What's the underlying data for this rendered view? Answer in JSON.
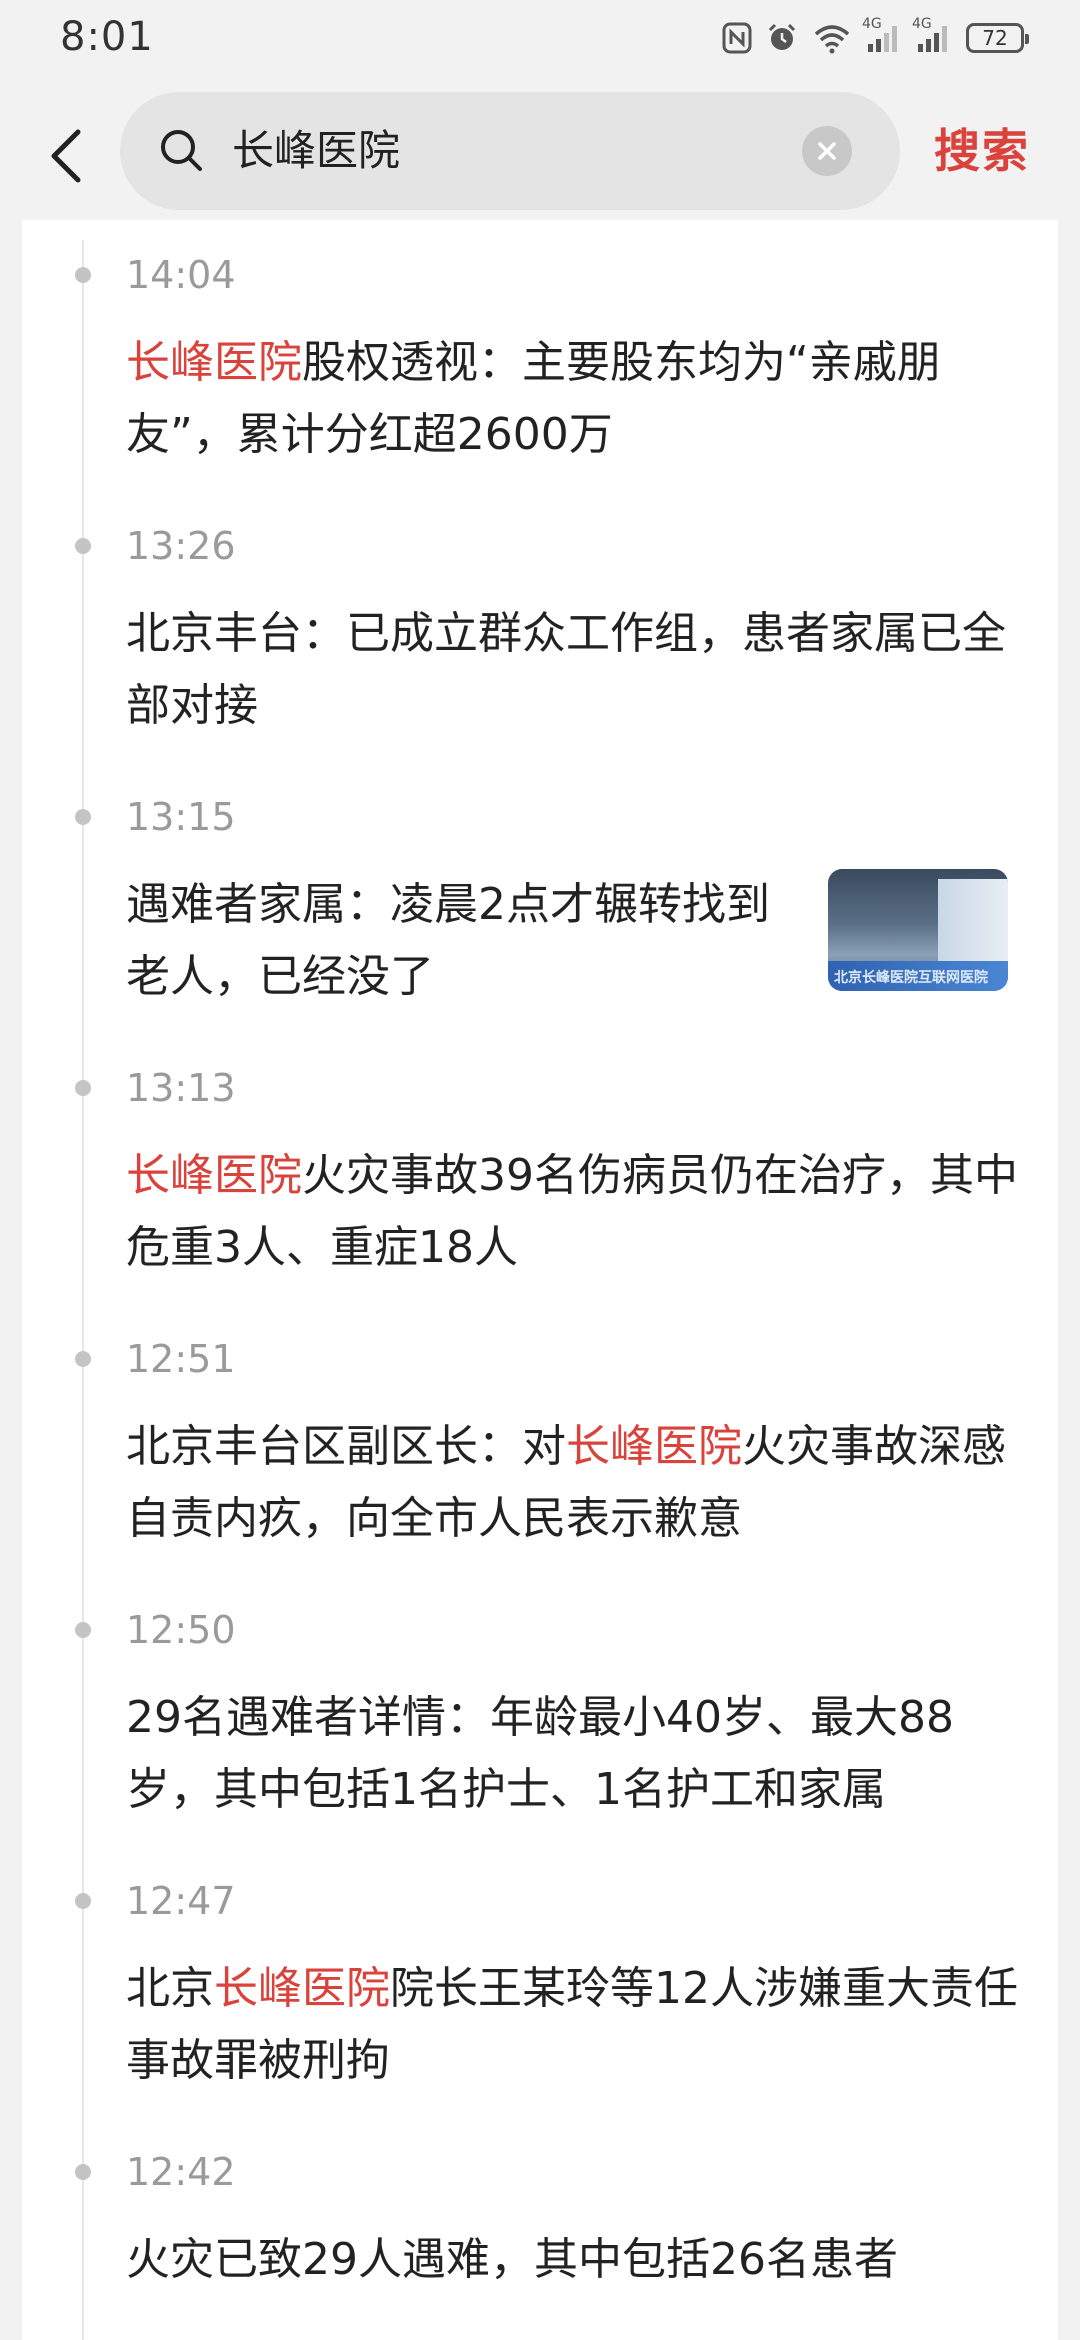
{
  "status_bar": {
    "time": "8:01",
    "battery": "72",
    "network_1": "4G",
    "network_2": "4G"
  },
  "header": {
    "search_query": "长峰医院",
    "search_button": "搜索"
  },
  "colors": {
    "highlight": "#d9433b",
    "text": "#222222",
    "time": "#9a9a9a"
  },
  "news": [
    {
      "time": "14:04",
      "title_parts": [
        {
          "text": "长峰医院",
          "highlight": true
        },
        {
          "text": "股权透视：主要股东均为“亲戚朋友”，累计分红超2600万",
          "highlight": false
        }
      ]
    },
    {
      "time": "13:26",
      "title_parts": [
        {
          "text": "北京丰台：已成立群众工作组，患者家属已全部对接",
          "highlight": false
        }
      ]
    },
    {
      "time": "13:15",
      "has_thumbnail": true,
      "thumbnail_text": "北京长峰医院互联网医院",
      "title_parts": [
        {
          "text": "遇难者家属：凌晨2点才辗转找到老人，已经没了",
          "highlight": false
        }
      ]
    },
    {
      "time": "13:13",
      "title_parts": [
        {
          "text": "长峰医院",
          "highlight": true
        },
        {
          "text": "火灾事故39名伤病员仍在治疗，其中危重3人、重症18人",
          "highlight": false
        }
      ]
    },
    {
      "time": "12:51",
      "title_parts": [
        {
          "text": "北京丰台区副区长：对",
          "highlight": false
        },
        {
          "text": "长峰医院",
          "highlight": true
        },
        {
          "text": "火灾事故深感自责内疚，向全市人民表示歉意",
          "highlight": false
        }
      ]
    },
    {
      "time": "12:50",
      "title_parts": [
        {
          "text": "29名遇难者详情：年龄最小40岁、最大88岁，其中包括1名护士、1名护工和家属",
          "highlight": false
        }
      ]
    },
    {
      "time": "12:47",
      "title_parts": [
        {
          "text": "北京",
          "highlight": false
        },
        {
          "text": "长峰医院",
          "highlight": true
        },
        {
          "text": "院长王某玲等12人涉嫌重大责任事故罪被刑拘",
          "highlight": false
        }
      ]
    },
    {
      "time": "12:42",
      "title_parts": [
        {
          "text": "火灾已致29人遇难，其中包括26名患者",
          "highlight": false
        }
      ]
    }
  ]
}
